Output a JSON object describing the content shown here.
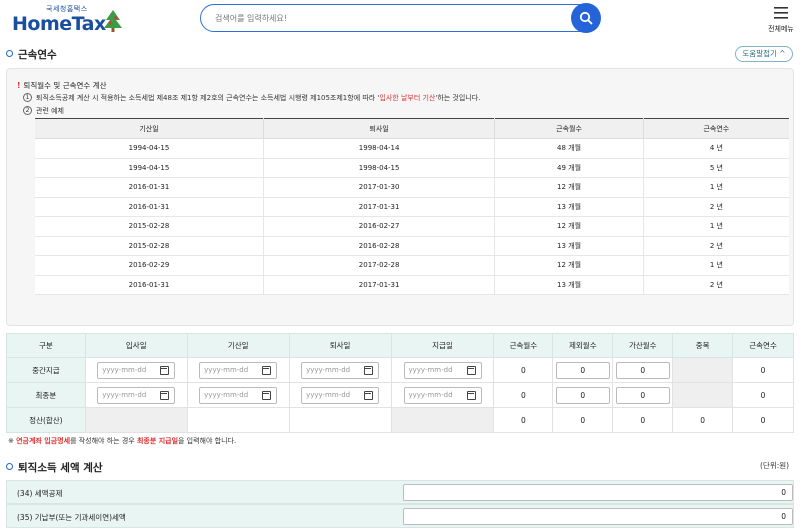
{
  "header": {
    "logo_small": "국세청홈택스",
    "logo_big": "HomeTax",
    "search_placeholder": "검색어를 입력하세요!",
    "menu_label": "전체메뉴"
  },
  "section1": {
    "title": "근속연수",
    "help_label": "도움말접기 ^"
  },
  "info": {
    "line1": "퇴직월수 및 근속연수 계산",
    "line2_num": "1",
    "line2_pre": "퇴직소득공제 계산 시 적용하는 소득세법 제48조 제1항 제2호의 근속연수는 소득세법 시행령 제105조제1항에 따라 '",
    "line2_red": "입사한 날부터 기산",
    "line2_post": "'하는 것입니다.",
    "line3_num": "2",
    "line3": "관련 예제"
  },
  "example_table": {
    "headers": [
      "기산일",
      "퇴사일",
      "근속월수",
      "근속연수"
    ],
    "rows": [
      [
        "1994-04-15",
        "1998-04-14",
        "48 개월",
        "4 년"
      ],
      [
        "1994-04-15",
        "1998-04-15",
        "49 개월",
        "5 년"
      ],
      [
        "2016-01-31",
        "2017-01-30",
        "12 개월",
        "1 년"
      ],
      [
        "2016-01-31",
        "2017-01-31",
        "13 개월",
        "2 년"
      ],
      [
        "2015-02-28",
        "2016-02-27",
        "12 개월",
        "1 년"
      ],
      [
        "2015-02-28",
        "2016-02-28",
        "13 개월",
        "2 년"
      ],
      [
        "2016-02-29",
        "2017-02-28",
        "12 개월",
        "1 년"
      ],
      [
        "2016-01-31",
        "2017-01-31",
        "13 개월",
        "2 년"
      ]
    ]
  },
  "main_table": {
    "headers": [
      "구분",
      "입사일",
      "기산일",
      "퇴사일",
      "지급일",
      "근속월수",
      "제외월수",
      "가산월수",
      "중복",
      "근속연수"
    ],
    "date_placeholder": "yyyy-mm-dd",
    "rows": [
      {
        "label": "중간지급",
        "months": "0",
        "excluded": "0",
        "added": "0",
        "years": "0"
      },
      {
        "label": "최종분",
        "months": "0",
        "excluded": "0",
        "added": "0",
        "years": "0"
      },
      {
        "label": "정산(합산)",
        "months": "0",
        "excluded": "0",
        "added": "0",
        "dup": "0",
        "years": "0"
      }
    ]
  },
  "note": {
    "prefix": "※ ",
    "b1": "연금계좌 입금명세",
    "mid": "를 작성해야 하는 경우 ",
    "b2": "최종분 지급일",
    "suffix": "을 입력해야 합니다."
  },
  "section2": {
    "title": "퇴직소득 세액 계산",
    "unit": "(단위:원)",
    "rows": [
      {
        "label": "(34) 세액공제",
        "value": "0"
      },
      {
        "label": "(35) 기납부(또는 기과세이연)세액",
        "value": "0"
      }
    ]
  },
  "colors": {
    "accent": "#2563d8",
    "header_bg": "#e9f5f3",
    "highlight_red": "#d33333"
  }
}
